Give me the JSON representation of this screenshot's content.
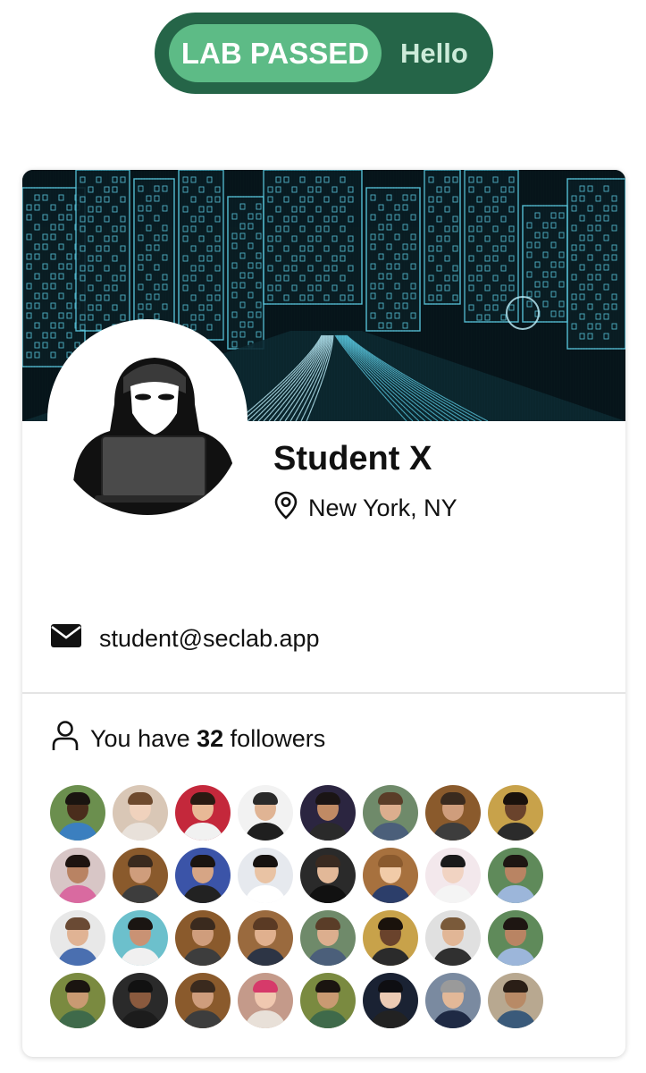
{
  "status_pill": {
    "badge": "LAB PASSED",
    "text": "Hello"
  },
  "profile": {
    "name": "Student X",
    "location": "New York, NY",
    "email": "student@seclab.app"
  },
  "followers": {
    "prefix": "You have ",
    "count": "32",
    "suffix": " followers",
    "avatars": [
      {
        "bg": "#6b8f4e",
        "skin": "#4a2d1c",
        "hair": "#1a1410",
        "shirt": "#3b7fbf"
      },
      {
        "bg": "#d9c7b6",
        "skin": "#f0d2bd",
        "hair": "#6e4a2e",
        "shirt": "#e8e1da"
      },
      {
        "bg": "#c4283b",
        "skin": "#e8b996",
        "hair": "#2a1a12",
        "shirt": "#f1f1f1"
      },
      {
        "bg": "#f2f2f2",
        "skin": "#e0b494",
        "hair": "#2a2a2a",
        "shirt": "#1f1f1f"
      },
      {
        "bg": "#2b2540",
        "skin": "#c08a64",
        "hair": "#1a1414",
        "shirt": "#2a2a2a"
      },
      {
        "bg": "#6f8a6a",
        "skin": "#dcae8e",
        "hair": "#5a3d28",
        "shirt": "#4b5f7a"
      },
      {
        "bg": "#8a5a2c",
        "skin": "#cf9d7c",
        "hair": "#3a2a1e",
        "shirt": "#3d3d3d"
      },
      {
        "bg": "#c8a24a",
        "skin": "#6a432c",
        "hair": "#1a120c",
        "shirt": "#2b2b2b"
      },
      {
        "bg": "#d8c6c6",
        "skin": "#b98363",
        "hair": "#1e1410",
        "shirt": "#d96aa0"
      },
      {
        "bg": "#8a5a2c",
        "skin": "#cf9d7c",
        "hair": "#3a2a1e",
        "shirt": "#3d3d3d"
      },
      {
        "bg": "#3b54a8",
        "skin": "#d6a585",
        "hair": "#1a1410",
        "shirt": "#222222"
      },
      {
        "bg": "#e6e9ee",
        "skin": "#e9c3a4",
        "hair": "#161210",
        "shirt": "#ffffff"
      },
      {
        "bg": "#2a2a2a",
        "skin": "#e2b898",
        "hair": "#3a2a20",
        "shirt": "#111111"
      },
      {
        "bg": "#a7713e",
        "skin": "#f1cba8",
        "hair": "#8a5a2e",
        "shirt": "#2c3e6a"
      },
      {
        "bg": "#f3e8ec",
        "skin": "#f1d3c2",
        "hair": "#1a1a1a",
        "shirt": "#f4f4f4"
      },
      {
        "bg": "#5f8a5a",
        "skin": "#b98463",
        "hair": "#1e1612",
        "shirt": "#9cb6da"
      },
      {
        "bg": "#e8e8e8",
        "skin": "#e0b394",
        "hair": "#6a4a34",
        "shirt": "#4a6fb0"
      },
      {
        "bg": "#6cc0cc",
        "skin": "#c99274",
        "hair": "#1a1512",
        "shirt": "#f0f0f0"
      },
      {
        "bg": "#8a5a2c",
        "skin": "#cf9d7c",
        "hair": "#3a2a1e",
        "shirt": "#3d3d3d"
      },
      {
        "bg": "#9a6a3e",
        "skin": "#e0b08e",
        "hair": "#5a3a24",
        "shirt": "#2d3545"
      },
      {
        "bg": "#6f8a6a",
        "skin": "#dcae8e",
        "hair": "#5a3d28",
        "shirt": "#4b5f7a"
      },
      {
        "bg": "#c8a24a",
        "skin": "#6a432c",
        "hair": "#1a120c",
        "shirt": "#2b2b2b"
      },
      {
        "bg": "#e0e0e0",
        "skin": "#e1b696",
        "hair": "#7a5a3a",
        "shirt": "#303030"
      },
      {
        "bg": "#5f8a5a",
        "skin": "#b98463",
        "hair": "#1e1612",
        "shirt": "#9cb6da"
      },
      {
        "bg": "#7a8a40",
        "skin": "#c99a72",
        "hair": "#1a1410",
        "shirt": "#3f6a4a"
      },
      {
        "bg": "#2a2a2a",
        "skin": "#8a5a3e",
        "hair": "#111111",
        "shirt": "#1c1c1c"
      },
      {
        "bg": "#8a5a2c",
        "skin": "#cf9d7c",
        "hair": "#3a2a1e",
        "shirt": "#3d3d3d"
      },
      {
        "bg": "#c49a8a",
        "skin": "#f0c8b0",
        "hair": "#d63a6a",
        "shirt": "#e8e0d8"
      },
      {
        "bg": "#7a8a40",
        "skin": "#c99a72",
        "hair": "#1a1410",
        "shirt": "#3f6a4a"
      },
      {
        "bg": "#1a2233",
        "skin": "#eccbb4",
        "hair": "#0e0e12",
        "shirt": "#222222"
      },
      {
        "bg": "#7a8aa0",
        "skin": "#e2b898",
        "hair": "#9a9a9a",
        "shirt": "#1f2a44"
      },
      {
        "bg": "#b8a890",
        "skin": "#b88a66",
        "hair": "#2a1e16",
        "shirt": "#3a5a7a"
      }
    ]
  },
  "colors": {
    "pill_bg": "#256548",
    "badge_bg": "#5dbb86",
    "banner_line": "#5fd3ec"
  }
}
